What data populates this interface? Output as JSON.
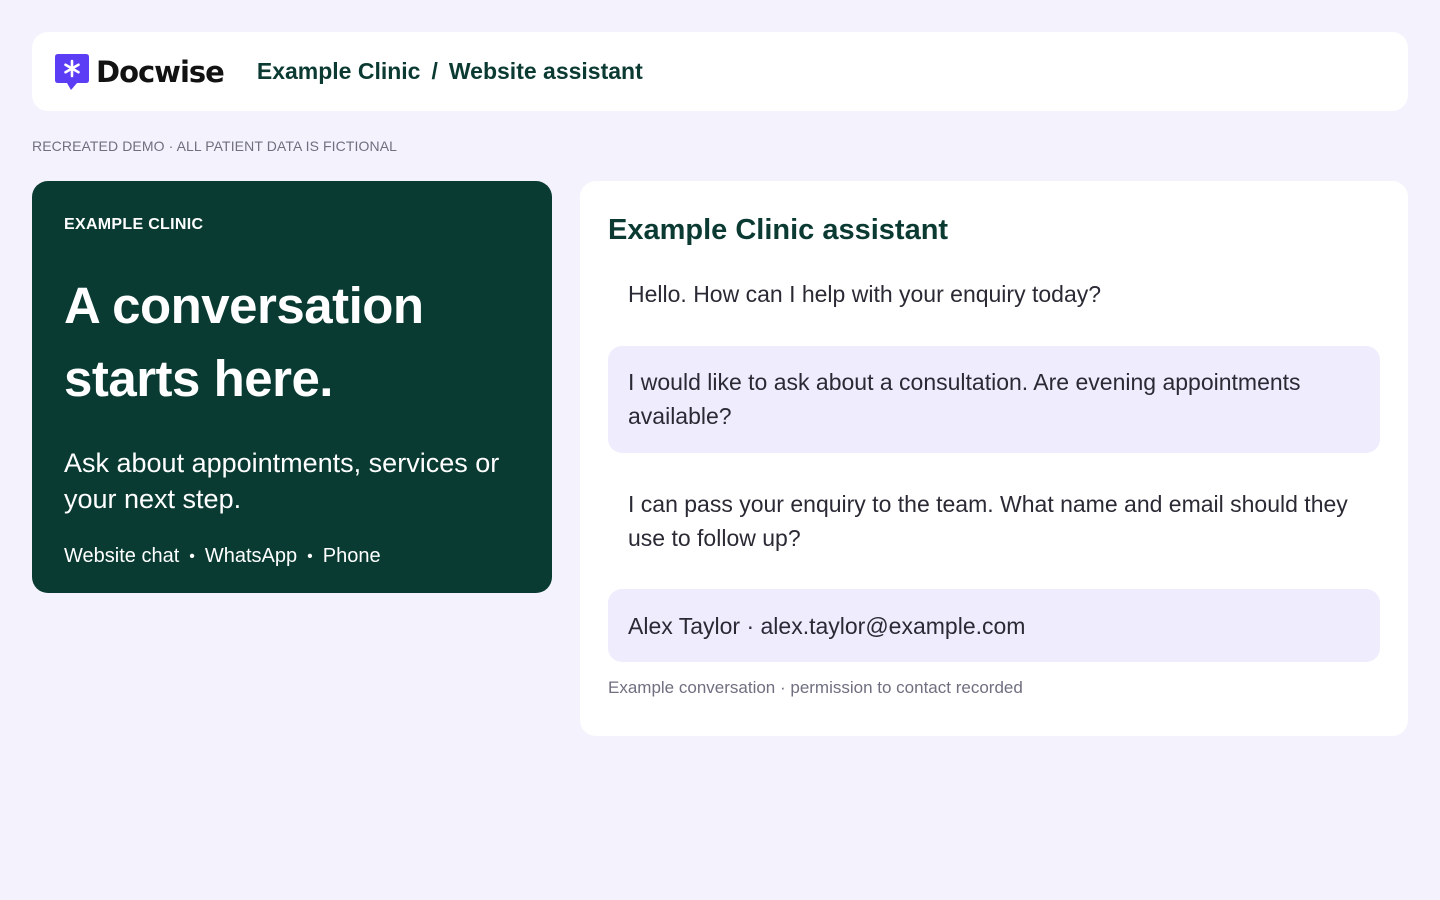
{
  "header": {
    "logo_text": "Docwise",
    "logo_icon": "asterisk-chat-bubble-icon",
    "breadcrumb": [
      "Example Clinic",
      "Website assistant"
    ],
    "separator": "/"
  },
  "demo_note": "RECREATED DEMO · ALL PATIENT DATA IS FICTIONAL",
  "hero": {
    "eyebrow": "EXAMPLE CLINIC",
    "heading_line1": "A conversation",
    "heading_line2": "starts here.",
    "subtitle": "Ask about appointments, services or your next step.",
    "channels": [
      "Website chat",
      "WhatsApp",
      "Phone"
    ]
  },
  "chat": {
    "title": "Example Clinic assistant",
    "messages": [
      {
        "role": "assistant",
        "text": "Hello. How can I help with your enquiry today?"
      },
      {
        "role": "user",
        "text": "I would like to ask about a consultation. Are evening appointments available?"
      },
      {
        "role": "assistant",
        "text": "I can pass your enquiry to the team. What name and email should they use to follow up?"
      },
      {
        "role": "user",
        "text": "Alex Taylor · alex.taylor@example.com"
      }
    ],
    "footer": "Example conversation · permission to contact recorded"
  },
  "colors": {
    "brand_purple": "#5b3df5",
    "hero_green": "#093b33",
    "title_green": "#0b3a32",
    "user_bubble": "#efecfd",
    "page_bg": "#f4f3fd"
  }
}
